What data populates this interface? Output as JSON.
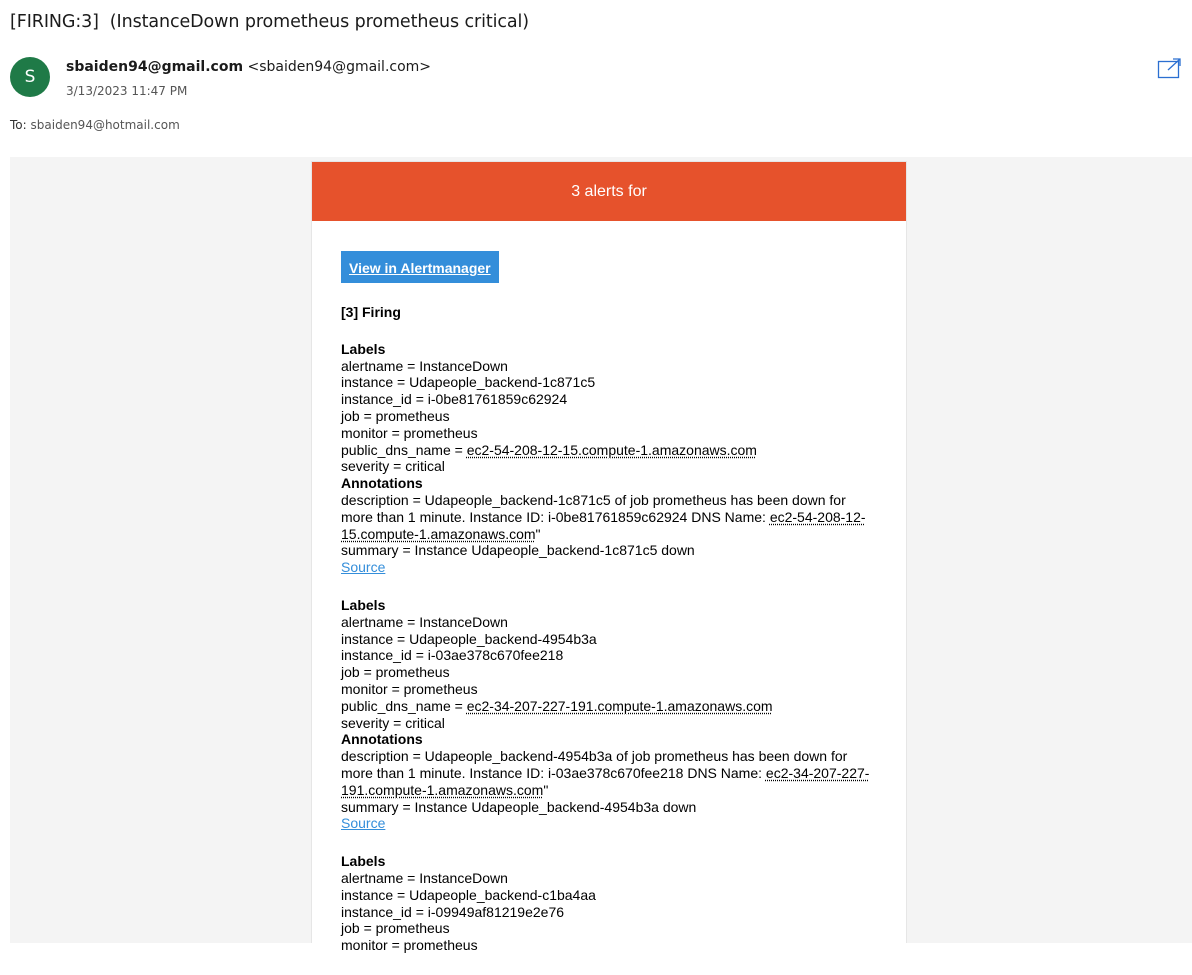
{
  "email": {
    "subject": "[FIRING:3]  (InstanceDown prometheus prometheus critical)",
    "avatar_initial": "S",
    "sender_name": "sbaiden94@gmail.com",
    "sender_email": "<sbaiden94@gmail.com>",
    "date": "3/13/2023 11:47 PM",
    "to_label": "To:",
    "to_address": "sbaiden94@hotmail.com",
    "popout_icon": "open-in-new-window-icon"
  },
  "message": {
    "banner": "3 alerts for",
    "button_label": "View in Alertmanager",
    "firing_header": "[3] Firing",
    "labels_header": "Labels",
    "annotations_header": "Annotations",
    "source_label": "Source",
    "alerts": [
      {
        "labels": {
          "alertname": "alertname = InstanceDown",
          "instance": "instance = Udapeople_backend-1c871c5",
          "instance_id": "instance_id = i-0be81761859c62924",
          "job": "job = prometheus",
          "monitor": "monitor = prometheus",
          "public_dns_prefix": "public_dns_name = ",
          "public_dns": "ec2-54-208-12-15.compute-1.amazonaws.com",
          "severity": "severity = critical"
        },
        "description_text": "description = Udapeople_backend-1c871c5 of job prometheus has been down for more than 1 minute. Instance ID: i-0be81761859c62924 DNS Name: ",
        "description_dns": "ec2-54-208-12-15.compute-1.amazonaws.com",
        "description_suffix": "\"",
        "summary": "summary = Instance Udapeople_backend-1c871c5 down"
      },
      {
        "labels": {
          "alertname": "alertname = InstanceDown",
          "instance": "instance = Udapeople_backend-4954b3a",
          "instance_id": "instance_id = i-03ae378c670fee218",
          "job": "job = prometheus",
          "monitor": "monitor = prometheus",
          "public_dns_prefix": "public_dns_name = ",
          "public_dns": "ec2-34-207-227-191.compute-1.amazonaws.com",
          "severity": "severity = critical"
        },
        "description_text": "description = Udapeople_backend-4954b3a of job prometheus has been down for more than 1 minute. Instance ID: i-03ae378c670fee218 DNS Name: ",
        "description_dns": "ec2-34-207-227-191.compute-1.amazonaws.com",
        "description_suffix": "\"",
        "summary": "summary = Instance Udapeople_backend-4954b3a down"
      },
      {
        "labels": {
          "alertname": "alertname = InstanceDown",
          "instance": "instance = Udapeople_backend-c1ba4aa",
          "instance_id": "instance_id = i-09949af81219e2e76",
          "job": "job = prometheus",
          "monitor": "monitor = prometheus"
        }
      }
    ]
  }
}
